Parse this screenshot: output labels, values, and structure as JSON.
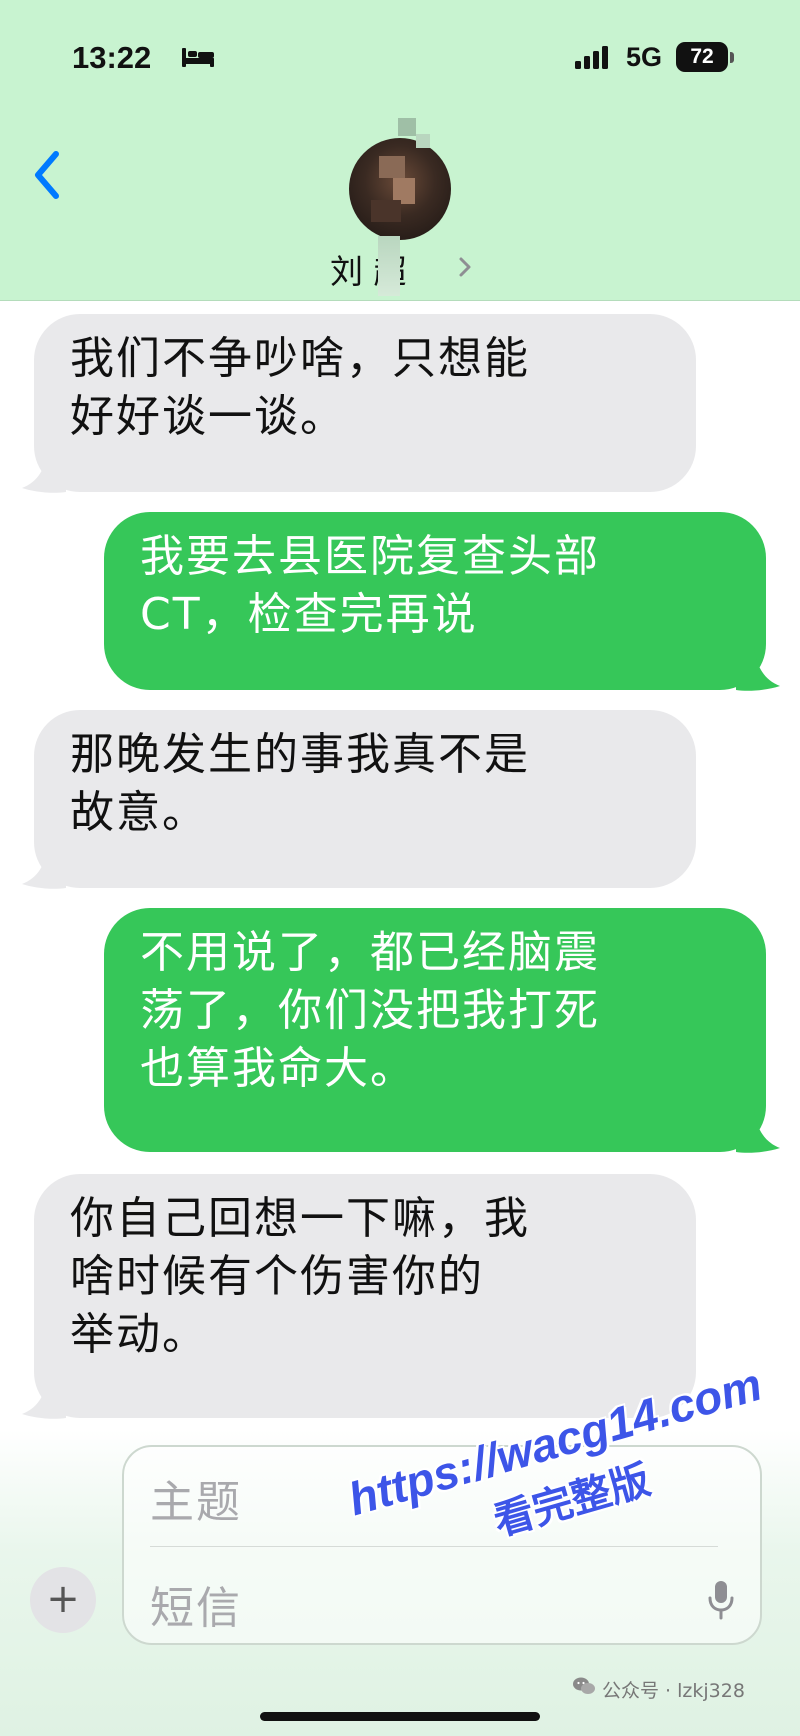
{
  "status_bar": {
    "time": "13:22",
    "network": "5G",
    "battery": "72",
    "icons": [
      "bed-icon",
      "signal-icon"
    ]
  },
  "header": {
    "contact_name": "刘 超",
    "icons": [
      "back-chevron-icon",
      "contact-avatar",
      "chevron-right-icon"
    ]
  },
  "messages": [
    {
      "direction": "incoming",
      "lines": [
        "我们不争吵啥，只想能",
        "好好谈一谈。"
      ]
    },
    {
      "direction": "outgoing",
      "lines": [
        "我要去县医院复查头部",
        "CT，检查完再说"
      ]
    },
    {
      "direction": "incoming",
      "lines": [
        "那晚发生的事我真不是",
        "故意。"
      ]
    },
    {
      "direction": "outgoing",
      "lines": [
        "不用说了，都已经脑震",
        "荡了，你们没把我打死",
        "也算我命大。"
      ]
    },
    {
      "direction": "incoming",
      "lines": [
        "你自己回想一下嘛，我",
        "啥时候有个伤害你的",
        "举动。"
      ]
    }
  ],
  "composer": {
    "plus_label": "+",
    "subject_placeholder": "主题",
    "message_placeholder": "短信",
    "icons": [
      "plus-icon",
      "microphone-icon"
    ]
  },
  "watermark": {
    "url": "https://wacg14.com",
    "subtitle": "看完整版"
  },
  "credit": {
    "text": "公众号 · lzkj328",
    "icon": "wechat-icon"
  },
  "colors": {
    "header_bg": "#c8f3d0",
    "incoming_bubble": "#e9e9eb",
    "outgoing_bubble": "#36c759",
    "ios_blue": "#007aff",
    "watermark": "#3d55e8"
  }
}
